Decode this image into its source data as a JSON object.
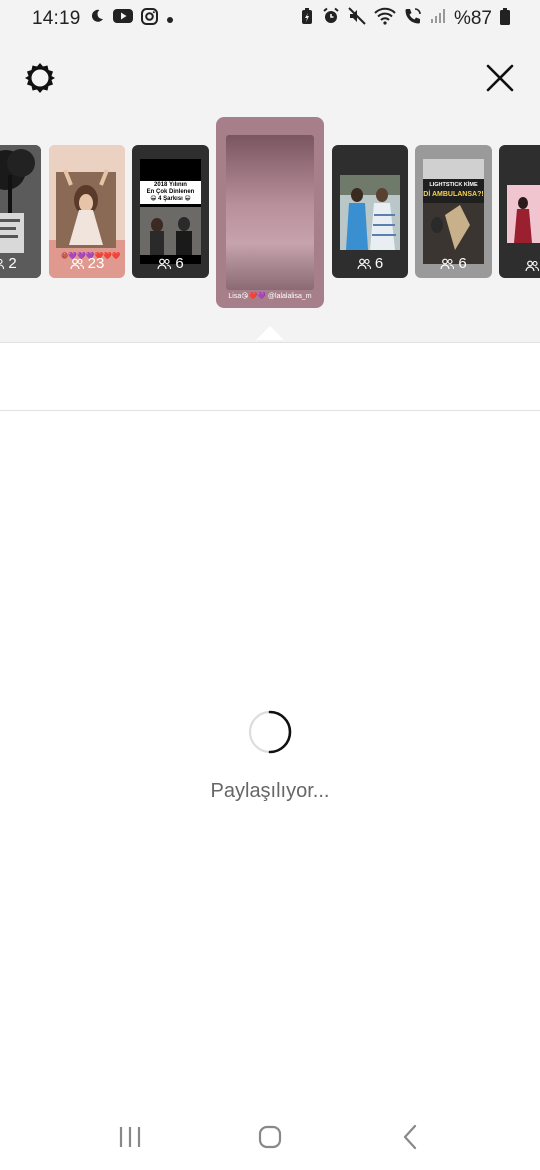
{
  "status_bar": {
    "time": "14:19",
    "battery": "%87",
    "left_icons": [
      "moon-icon",
      "youtube-icon",
      "instagram-icon",
      "dot-icon"
    ],
    "right_icons": [
      "battery-saver-icon",
      "alarm-icon",
      "mute-icon",
      "wifi-icon",
      "wifi-call-icon",
      "signal-icon",
      "battery-icon"
    ]
  },
  "header": {
    "settings_icon": "settings-gear-icon",
    "close_icon": "close-icon"
  },
  "stories": [
    {
      "id": "story-1",
      "viewers": "2",
      "theme": "bw-tree"
    },
    {
      "id": "story-2",
      "viewers": "23",
      "theme": "pink-photo"
    },
    {
      "id": "story-3",
      "viewers": "6",
      "theme": "dark-text",
      "title_lines": [
        "2018 Yılının",
        "En Çok Dinlenen",
        "😁 4 Şarkısı 😁"
      ]
    },
    {
      "id": "story-4",
      "viewers": "",
      "theme": "mauve-selected",
      "caption": "Lisa😘❤️💜 @lalalalisa_m"
    },
    {
      "id": "story-5",
      "viewers": "6",
      "theme": "two-women"
    },
    {
      "id": "story-6",
      "viewers": "6",
      "theme": "event",
      "banner_text": [
        "LIGHTSTICK KİME",
        "Dİ AMBULANSA?!"
      ]
    },
    {
      "id": "story-7",
      "viewers": "",
      "theme": "pink-event"
    }
  ],
  "progress": {
    "label": "Paylaşılıyor..."
  },
  "nav_bar": {
    "recent_icon": "recent-apps-icon",
    "home_icon": "home-icon",
    "back_icon": "back-icon"
  },
  "colors": {
    "top_panel": "#f3f3f3",
    "selected_story": "#a77f8b",
    "spinner": "#111111"
  }
}
